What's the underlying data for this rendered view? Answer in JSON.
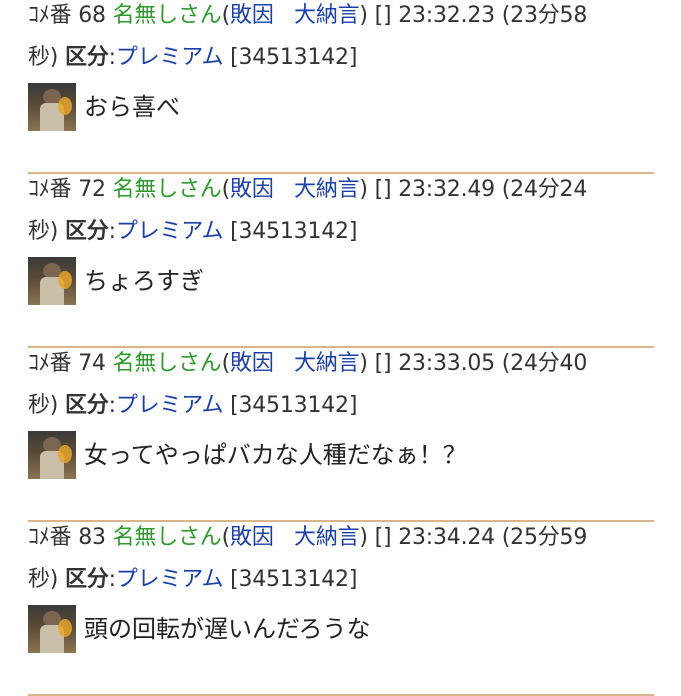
{
  "comments": [
    {
      "comment_label": "ｺﾒ番",
      "number": "68",
      "name": "名無しさん",
      "paren_open": "(",
      "cause": "敗因",
      "rank": "大納言",
      "paren_close": ")",
      "brackets": "[]",
      "time": "23:32.23",
      "elapsed_line1": "(23分58",
      "elapsed_line2": "秒)",
      "kubun_label": "区分",
      "kubun_colon": ":",
      "kubun_value": "プレミアム",
      "user_id": "[34513142]",
      "message": "おら喜べ"
    },
    {
      "comment_label": "ｺﾒ番",
      "number": "72",
      "name": "名無しさん",
      "paren_open": "(",
      "cause": "敗因",
      "rank": "大納言",
      "paren_close": ")",
      "brackets": "[]",
      "time": "23:32.49",
      "elapsed_line1": "(24分24",
      "elapsed_line2": "秒)",
      "kubun_label": "区分",
      "kubun_colon": ":",
      "kubun_value": "プレミアム",
      "user_id": "[34513142]",
      "message": "ちょろすぎ"
    },
    {
      "comment_label": "ｺﾒ番",
      "number": "74",
      "name": "名無しさん",
      "paren_open": "(",
      "cause": "敗因",
      "rank": "大納言",
      "paren_close": ")",
      "brackets": "[]",
      "time": "23:33.05",
      "elapsed_line1": "(24分40",
      "elapsed_line2": "秒)",
      "kubun_label": "区分",
      "kubun_colon": ":",
      "kubun_value": "プレミアム",
      "user_id": "[34513142]",
      "message": "女ってやっぱバカな人種だなぁ！？"
    },
    {
      "comment_label": "ｺﾒ番",
      "number": "83",
      "name": "名無しさん",
      "paren_open": "(",
      "cause": "敗因",
      "rank": "大納言",
      "paren_close": ")",
      "brackets": "[]",
      "time": "23:34.24",
      "elapsed_line1": "(25分59",
      "elapsed_line2": "秒)",
      "kubun_label": "区分",
      "kubun_colon": ":",
      "kubun_value": "プレミアム",
      "user_id": "[34513142]",
      "message": "頭の回転が遅いんだろうな"
    }
  ]
}
